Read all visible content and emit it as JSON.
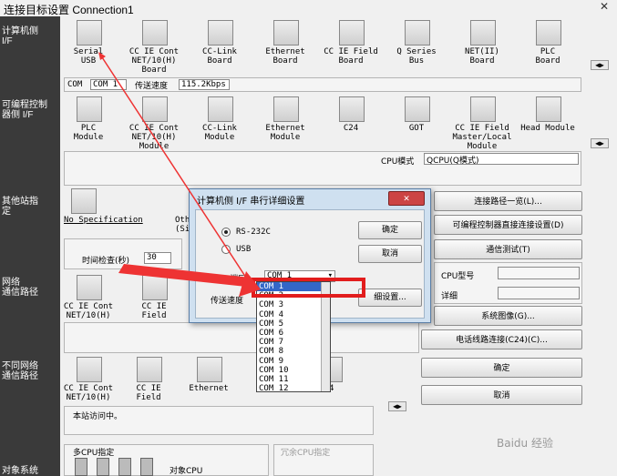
{
  "window": {
    "title": "连接目标设置 Connection1",
    "close_icon": "close-icon"
  },
  "sidebar": {
    "pc_if": "计算机侧\nI/F",
    "plc_if": "可编程控制\n器侧 I/F",
    "other_station": "其他站指\n定",
    "network_route": "网络\n通信路径",
    "diff_network_route": "不同网络\n通信路径",
    "target_system": "对象系统"
  },
  "pc_devices": [
    {
      "label": "Serial\nUSB"
    },
    {
      "label": "CC IE Cont\nNET/10(H)\nBoard"
    },
    {
      "label": "CC-Link\nBoard"
    },
    {
      "label": "Ethernet\nBoard"
    },
    {
      "label": "CC IE Field\nBoard"
    },
    {
      "label": "Q Series\nBus"
    },
    {
      "label": "NET(II)\nBoard"
    },
    {
      "label": "PLC\nBoard"
    }
  ],
  "com_row": {
    "com_label": "COM",
    "com_value": "COM 1",
    "speed_label": "传送速度",
    "speed_value": "115.2Kbps"
  },
  "plc_devices": [
    {
      "label": "PLC\nModule"
    },
    {
      "label": "CC IE Cont\nNET/10(H)\nModule"
    },
    {
      "label": "CC-Link\nModule"
    },
    {
      "label": "Ethernet\nModule"
    },
    {
      "label": "C24"
    },
    {
      "label": "GOT"
    },
    {
      "label": "CC IE Field\nMaster/Local\nModule"
    },
    {
      "label": "Head Module"
    }
  ],
  "cpu_mode": {
    "label": "CPU模式",
    "value": "QCPU(Q模式)"
  },
  "other_station": {
    "no_spec_label": "No Specification",
    "partial_label": "Oth\n(Si",
    "time_check_label": "时间检查(秒)",
    "time_check_value": "30"
  },
  "network_devices": [
    {
      "label": "CC IE Cont\nNET/10(H)"
    },
    {
      "label": "CC IE\nField"
    }
  ],
  "diff_network_devices": [
    {
      "label": "CC IE Cont\nNET/10(H)"
    },
    {
      "label": "CC IE\nField"
    },
    {
      "label": "Ethernet"
    },
    {
      "label": "C"
    },
    {
      "label": "24"
    }
  ],
  "status_text": "本站访问中。",
  "multi_cpu": {
    "label": "多CPU指定",
    "target_cpu_label": "对象CPU",
    "redundant_label": "冗余CPU指定"
  },
  "right_buttons": {
    "connection_route_list": "连接路径一览(L)...",
    "plc_direct_connection": "可编程控制器直接连接设置(D)",
    "comm_test": "通信测试(T)",
    "cpu_type_label": "CPU型号",
    "detail_label": "详细",
    "system_image": "系统图像(G)...",
    "phone_line": "电话线路连接(C24)(C)...",
    "ok": "确定",
    "cancel": "取消"
  },
  "dialog": {
    "title": "计算机侧 I/F 串行详细设置",
    "rs232c": "RS-232C",
    "usb": "USB",
    "com_port_label": "COM端口",
    "com_port_value": "COM 1",
    "speed_label": "传送速度",
    "ok": "确定",
    "cancel": "取消",
    "detail_settings": "细设置..."
  },
  "com_dropdown": {
    "options": [
      "COM 1",
      "COM 2",
      "COM 3",
      "COM 4",
      "COM 5",
      "COM 6",
      "COM 7",
      "COM 8",
      "COM 9",
      "COM 10",
      "COM 11",
      "COM 12"
    ],
    "selected": "COM 1"
  },
  "watermark": "Baidu 经验",
  "colors": {
    "sidebar": "#3a3a3a",
    "highlight_box": "#e21d1d",
    "selected_option": "#3367c8"
  }
}
